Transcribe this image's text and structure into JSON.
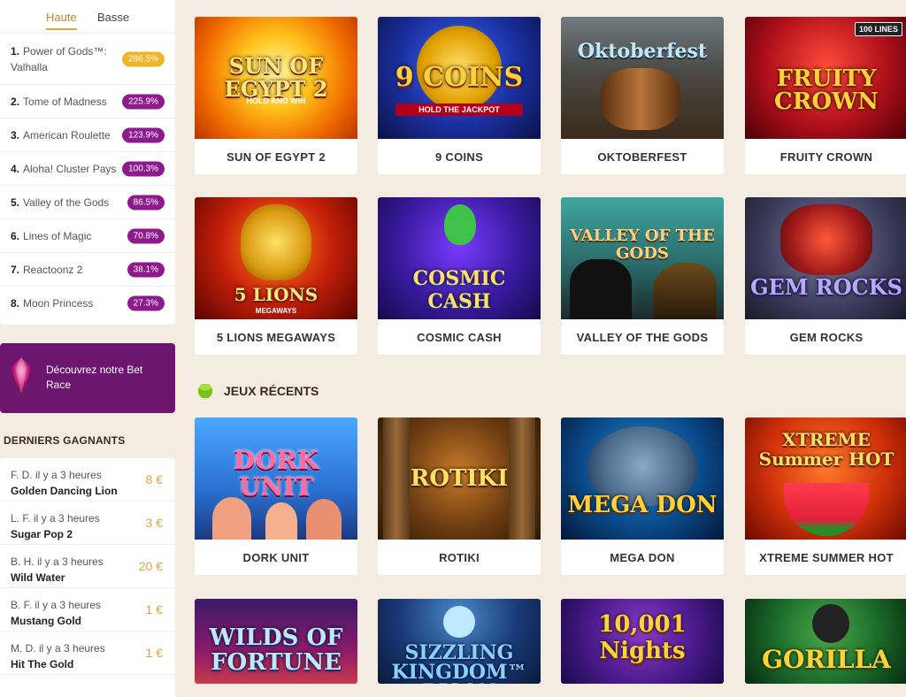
{
  "rtp": {
    "tabs": [
      "Haute",
      "Basse"
    ],
    "items": [
      {
        "rank": "1.",
        "name": "Power of Gods™: Valhalla",
        "value": "286.5%"
      },
      {
        "rank": "2.",
        "name": "Tome of Madness",
        "value": "225.9%"
      },
      {
        "rank": "3.",
        "name": "American Roulette",
        "value": "123.9%"
      },
      {
        "rank": "4.",
        "name": "Aloha! Cluster Pays",
        "value": "100.3%"
      },
      {
        "rank": "5.",
        "name": "Valley of the Gods",
        "value": "86.5%"
      },
      {
        "rank": "6.",
        "name": "Lines of Magic",
        "value": "70.8%"
      },
      {
        "rank": "7.",
        "name": "Reactoonz 2",
        "value": "38.1%"
      },
      {
        "rank": "8.",
        "name": "Moon Princess",
        "value": "27.3%"
      }
    ]
  },
  "bet_race": {
    "text": "Découvrez notre Bet Race"
  },
  "winners": {
    "title": "DERNIERS GAGNANTS",
    "items": [
      {
        "who": "F. D. il y a 3 heures",
        "game": "Golden Dancing Lion",
        "amount": "8 €"
      },
      {
        "who": "L. F. il y a 3 heures",
        "game": "Sugar Pop 2",
        "amount": "3 €"
      },
      {
        "who": "B. H. il y a 3 heures",
        "game": "Wild Water",
        "amount": "20 €"
      },
      {
        "who": "B. F. il y a 3 heures",
        "game": "Mustang Gold",
        "amount": "1 €"
      },
      {
        "who": "M. D. il y a 3 heures",
        "game": "Hit The Gold",
        "amount": "1 €"
      }
    ]
  },
  "recent_title": "JEUX RÉCENTS",
  "games": {
    "row1": [
      {
        "name": "SUN OF EGYPT 2",
        "logo": "SUN OF EGYPT 2",
        "sublogo": "HOLD AND WIN"
      },
      {
        "name": "9 COINS",
        "logo": "9 COINS",
        "sublogo": "HOLD THE JACKPOT"
      },
      {
        "name": "OKTOBERFEST",
        "logo": "Oktoberfest",
        "sublogo": ""
      },
      {
        "name": "FRUITY CROWN",
        "logo": "FRUITY CROWN",
        "sublogo": "100 LINES"
      }
    ],
    "row2": [
      {
        "name": "5 LIONS MEGAWAYS",
        "logo": "5 LIONS",
        "sublogo": "MEGAWAYS"
      },
      {
        "name": "COSMIC CASH",
        "logo": "COSMIC CASH",
        "sublogo": ""
      },
      {
        "name": "VALLEY OF THE GODS",
        "logo": "VALLEY OF THE GODS",
        "sublogo": ""
      },
      {
        "name": "GEM ROCKS",
        "logo": "GEM ROCKS",
        "sublogo": ""
      }
    ],
    "row3": [
      {
        "name": "DORK UNIT",
        "logo": "DORK UNIT",
        "sublogo": ""
      },
      {
        "name": "ROTIKI",
        "logo": "ROTIKI",
        "sublogo": ""
      },
      {
        "name": "MEGA DON",
        "logo": "MEGA DON",
        "sublogo": ""
      },
      {
        "name": "XTREME SUMMER HOT",
        "logo": "XTREME Summer HOT",
        "sublogo": ""
      }
    ],
    "row4": [
      {
        "logo": "WILDS OF FORTUNE",
        "sublogo": ""
      },
      {
        "logo": "SIZZLING KINGDOM™ BISON",
        "sublogo": ""
      },
      {
        "logo": "10,001 Nights",
        "sublogo": ""
      },
      {
        "logo": "GORILLA",
        "sublogo": ""
      }
    ]
  },
  "colors": {
    "page_bg": "#f4ece0",
    "accent_gold": "#d9a642",
    "badge_purple": "#8e1a8e",
    "bet_race_bg": "#6c1670"
  }
}
